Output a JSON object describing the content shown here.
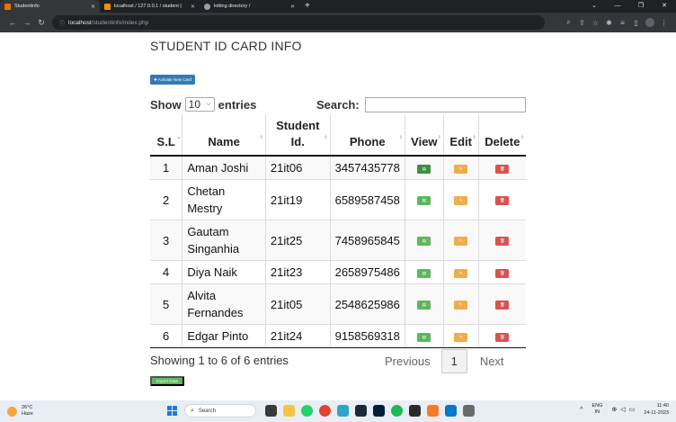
{
  "browser": {
    "tabs": [
      {
        "label": "Studentinfo",
        "active": true,
        "favicon_color": "#e8710a"
      },
      {
        "label": "localhost / 127.0.0.1 / student |",
        "active": false,
        "favicon_color": "#f29111"
      },
      {
        "label": "lotting directory /",
        "active": false,
        "favicon_color": "#9aa0a6"
      }
    ],
    "new_tab": "+",
    "url_host": "localhost",
    "url_path": "/studentinfo/index.php"
  },
  "page": {
    "title": "STUDENT ID CARD INFO",
    "activate_button": "✚ Activate New Card",
    "show_label": "Show",
    "entries_label": "entries",
    "page_length": "10",
    "search_label": "Search:",
    "search_value": "",
    "columns": [
      "S.L",
      "Name",
      "Student Id.",
      "Phone",
      "View",
      "Edit",
      "Delete"
    ],
    "rows": [
      {
        "sl": "1",
        "name": "Aman Joshi",
        "id": "21it06",
        "phone": "3457435778",
        "view_dark": true
      },
      {
        "sl": "2",
        "name": "Chetan Mestry",
        "id": "21it19",
        "phone": "6589587458",
        "view_dark": false
      },
      {
        "sl": "3",
        "name": "Gautam Singanhia",
        "id": "21it25",
        "phone": "7458965845",
        "view_dark": false
      },
      {
        "sl": "4",
        "name": "Diya Naik",
        "id": "21it23",
        "phone": "2658975486",
        "view_dark": false
      },
      {
        "sl": "5",
        "name": "Alvita Fernandes",
        "id": "21it05",
        "phone": "2548625986",
        "view_dark": false
      },
      {
        "sl": "6",
        "name": "Edgar Pinto",
        "id": "21it24",
        "phone": "9158569318",
        "view_dark": false
      }
    ],
    "info": "Showing 1 to 6 of 6 entries",
    "pagination": {
      "previous": "Previous",
      "current": "1",
      "next": "Next"
    },
    "export_button": "Export Data"
  },
  "taskbar": {
    "weather_temp": "26°C",
    "weather_desc": "Haze",
    "search_placeholder": "Search",
    "lang_line1": "ENG",
    "lang_line2": "IN",
    "time": "11:40",
    "date": "24-11-2023"
  },
  "colors": {
    "primary": "#337ab7",
    "success": "#5cb85c",
    "warning": "#f0ad4e",
    "danger": "#d9534f"
  }
}
